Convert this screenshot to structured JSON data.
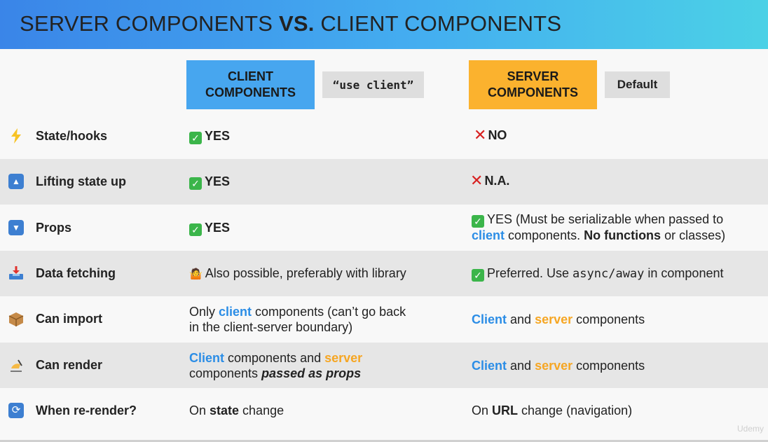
{
  "header": {
    "title_part1": "SERVER COMPONENTS ",
    "title_bold": "VS.",
    "title_part2": " CLIENT COMPONENTS"
  },
  "columns": {
    "client_badge_line1": "CLIENT",
    "client_badge_line2": "COMPONENTS",
    "client_tag": "“use client”",
    "server_badge_line1": "SERVER",
    "server_badge_line2": "COMPONENTS",
    "server_tag": "Default"
  },
  "rows": [
    {
      "icon": "lightning-icon",
      "label": "State/hooks",
      "client": "YES",
      "server": "NO"
    },
    {
      "icon": "up-arrow-icon",
      "label": "Lifting state up",
      "client": "YES",
      "server": "N.A."
    },
    {
      "icon": "down-arrow-icon",
      "label": "Props",
      "client": "YES",
      "server_line1": "YES (Must be serializable when passed to",
      "server_line2_blue": "client",
      "server_line2_a": " components. ",
      "server_line2_bold": "No functions",
      "server_line2_b": " or classes)"
    },
    {
      "icon": "inbox-tray-icon",
      "label": "Data fetching",
      "client": "Also possible, preferably with library",
      "server_a": "Preferred. Use ",
      "server_code": "async/away",
      "server_b": " in component"
    },
    {
      "icon": "package-icon",
      "label": "Can import",
      "client_a": "Only ",
      "client_blue": "client",
      "client_b": " components (can’t go back",
      "client_line2": "in the client-server boundary)",
      "server_blue": "Client",
      "server_and": " and ",
      "server_orange": "server",
      "server_rest": " components"
    },
    {
      "icon": "writing-hand-icon",
      "label": "Can render",
      "client_blue": "Client",
      "client_and": " components and ",
      "client_orange": "server",
      "client_line2_a": "components ",
      "client_line2_bi": "passed as props",
      "server_blue": "Client",
      "server_and": " and ",
      "server_orange": "server",
      "server_rest": " components"
    },
    {
      "icon": "refresh-icon",
      "label": "When re-render?",
      "client_a": "On ",
      "client_bold": "state",
      "client_b": " change",
      "server_a": "On ",
      "server_bold": "URL",
      "server_b": " change (navigation)"
    }
  ],
  "watermark": "Udemy",
  "colors": {
    "client_blue": "#47a6ef",
    "server_orange": "#fbb22e",
    "check_green": "#3bb54a",
    "cross_red": "#d82020"
  }
}
